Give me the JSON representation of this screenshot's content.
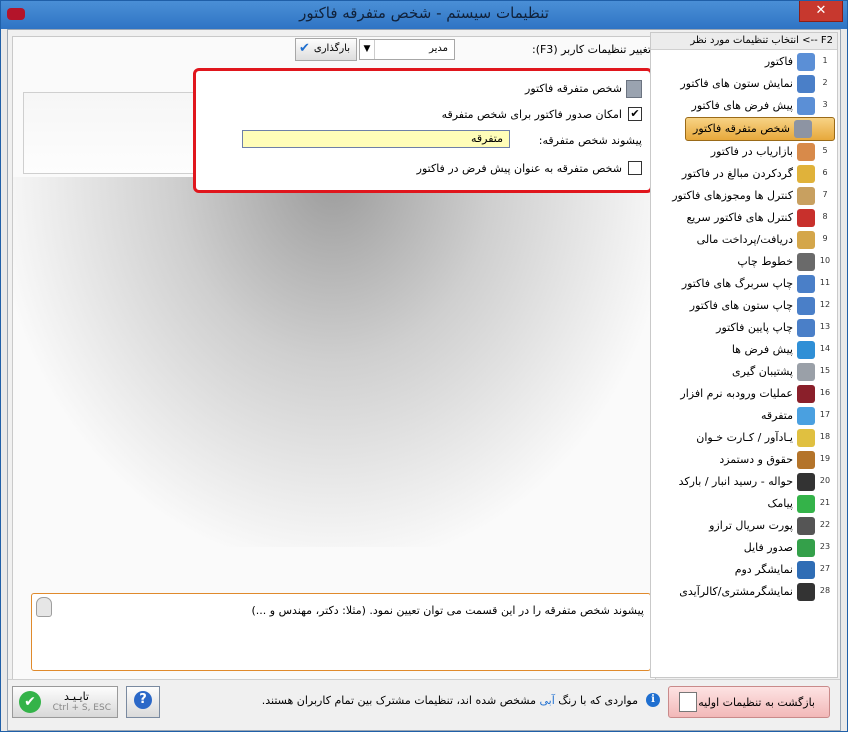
{
  "window": {
    "title": "تنظیمات سیستم - شخص متفرقه فاکتور",
    "close_glyph": "✕"
  },
  "toolbar": {
    "user_label": "تغییر تنظیمات کاربر (F3):",
    "user_value": "مدیر",
    "load_button": "بارگذاری"
  },
  "section": {
    "title": "شخص متفرقه فاکتور",
    "allow_issue_label": "امکان صدور فاکتور برای شخص متفرقه",
    "allow_issue_checked": "✔",
    "prefix_label": "پیشوند شخص متفرقه:",
    "prefix_value": "متفرقه",
    "default_person_label": "شخص متفرقه به عنوان پیش فرض در فاکتور",
    "default_person_checked": ""
  },
  "help": {
    "text": "پیشوند شخص متفرقه را در این قسمت می توان تعیین نمود. (مثلا: دکتر، مهندس و ...)"
  },
  "sidebar": {
    "header": "F2 --> انتخاب تنظیمات مورد نظر",
    "items": [
      {
        "num": "1",
        "label": "فاکتور",
        "color": "#5b8fd6"
      },
      {
        "num": "2",
        "label": "نمایش ستون های فاکتور",
        "color": "#4a7fc8"
      },
      {
        "num": "3",
        "label": "پیش فرض های فاکتور",
        "color": "#5b8fd6"
      },
      {
        "num": "4",
        "label": "شخص متفرقه فاکتور",
        "color": "#8d94a3"
      },
      {
        "num": "5",
        "label": "بازاریاب در فاکتور",
        "color": "#d88a4a"
      },
      {
        "num": "6",
        "label": "گردکردن مبالغ در فاکتور",
        "color": "#e0b23a"
      },
      {
        "num": "7",
        "label": "کنترل ها ومجوزهای فاکتور",
        "color": "#c8a060"
      },
      {
        "num": "8",
        "label": "کنترل های فاکتور سریع",
        "color": "#c8302c"
      },
      {
        "num": "9",
        "label": "دریافت/پرداخت مالی",
        "color": "#d4a64a"
      },
      {
        "num": "10",
        "label": "خطوط چاپ",
        "color": "#6a6a6a"
      },
      {
        "num": "11",
        "label": "چاپ سربرگ های فاکتور",
        "color": "#4a7fc8"
      },
      {
        "num": "12",
        "label": "چاپ ستون های فاکتور",
        "color": "#4a7fc8"
      },
      {
        "num": "13",
        "label": "چاپ پایین فاکتور",
        "color": "#4a7fc8"
      },
      {
        "num": "14",
        "label": "پیش فرض ها",
        "color": "#2f8fd6"
      },
      {
        "num": "15",
        "label": "پشتیبان گیری",
        "color": "#9aa0a8"
      },
      {
        "num": "16",
        "label": "عملیات ورودبه نرم افزار",
        "color": "#8a1f2a"
      },
      {
        "num": "17",
        "label": "متفرقه",
        "color": "#4aa0e0"
      },
      {
        "num": "18",
        "label": "یـادآور / کـارت خـوان",
        "color": "#e0c040"
      },
      {
        "num": "19",
        "label": "حقوق و دستمزد",
        "color": "#b4742a"
      },
      {
        "num": "20",
        "label": "حواله - رسید انبار / بارکد",
        "color": "#333333"
      },
      {
        "num": "21",
        "label": "پیامک",
        "color": "#34b349"
      },
      {
        "num": "22",
        "label": "پورت سریال ترازو",
        "color": "#555555"
      },
      {
        "num": "23",
        "label": "صدور فایل",
        "color": "#34a04a"
      },
      {
        "num": "27",
        "label": "نمایشگر دوم",
        "color": "#2f6db5"
      },
      {
        "num": "28",
        "label": "نمایشگرمشتری/کالرآیدی",
        "color": "#333333"
      }
    ]
  },
  "footer": {
    "reset_button": "بازگشت به تنظیمات اولیه",
    "info_text_before": "مواردی که با رنگ",
    "info_text_blue": "آبی",
    "info_text_after": "مشخص شده اند، تنظیمات مشترک بین تمام کاربران هستند.",
    "help_button": "?",
    "ok_button": "تایـیـد",
    "ok_shortcut": "Ctrl + S, ESC"
  }
}
